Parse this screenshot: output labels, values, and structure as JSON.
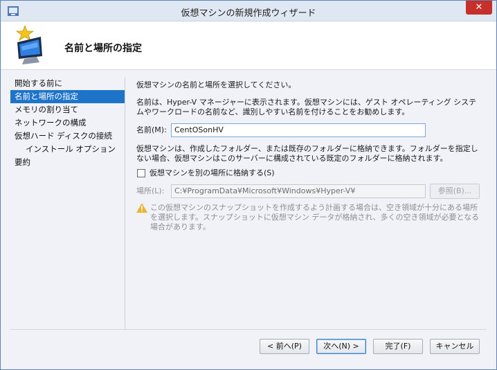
{
  "window": {
    "title": "仮想マシンの新規作成ウィザード",
    "close_label": "✕"
  },
  "header": {
    "title": "名前と場所の指定"
  },
  "nav": {
    "items": [
      {
        "label": "開始する前に",
        "active": false,
        "sub": false
      },
      {
        "label": "名前と場所の指定",
        "active": true,
        "sub": false
      },
      {
        "label": "メモリの割り当て",
        "active": false,
        "sub": false
      },
      {
        "label": "ネットワークの構成",
        "active": false,
        "sub": false
      },
      {
        "label": "仮想ハード ディスクの接続",
        "active": false,
        "sub": false
      },
      {
        "label": "インストール オプション",
        "active": false,
        "sub": true
      },
      {
        "label": "要約",
        "active": false,
        "sub": false
      }
    ]
  },
  "main": {
    "intro": "仮想マシンの名前と場所を選択してください。",
    "name_help": "名前は、Hyper-V マネージャーに表示されます。仮想マシンには、ゲスト オペレーティング システムやワークロードの名前など、識別しやすい名前を付けることをお勧めします。",
    "name_label": "名前(M):",
    "name_value": "CentOSonHV",
    "folder_help": "仮想マシンは、作成したフォルダー、または既存のフォルダーに格納できます。フォルダーを指定しない場合、仮想マシンはこのサーバーに構成されている既定のフォルダーに格納されます。",
    "store_checkbox_label": "仮想マシンを別の場所に格納する(S)",
    "store_checked": false,
    "location_label": "場所(L):",
    "location_value": "C:¥ProgramData¥Microsoft¥Windows¥Hyper-V¥",
    "browse_label": "参照(B)...",
    "warning_text": "この仮想マシンのスナップショットを作成するよう計画する場合は、空き領域が十分にある場所を選択します。スナップショットに仮想マシン データが格納され、多くの空き領域が必要となる場合があります。"
  },
  "footer": {
    "back_label": "< 前へ(P)",
    "next_label": "次へ(N) >",
    "finish_label": "完了(F)",
    "cancel_label": "キャンセル"
  },
  "colors": {
    "accent": "#1e74c8",
    "close": "#c7302a",
    "warning": "#e8b431"
  }
}
